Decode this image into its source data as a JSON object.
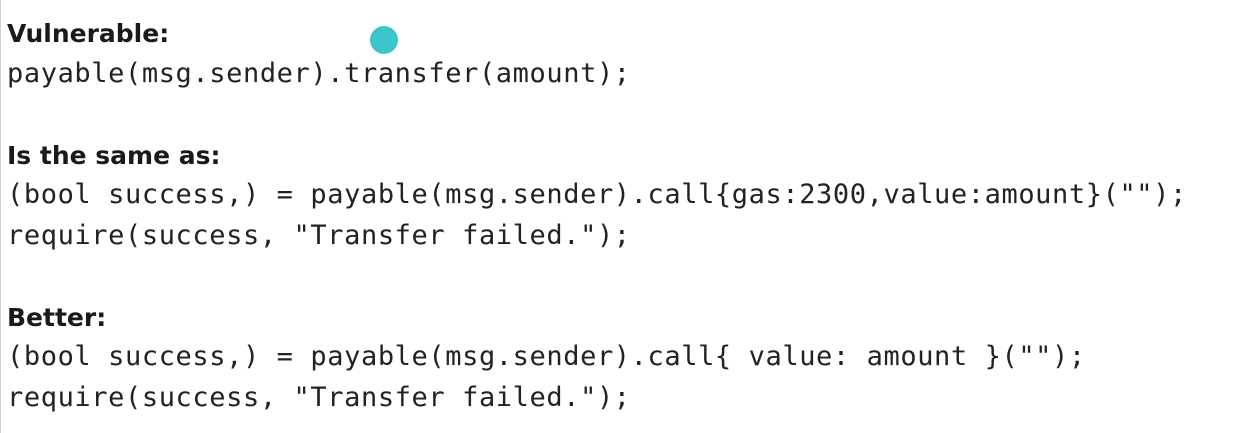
{
  "sections": {
    "vulnerable": {
      "heading": "Vulnerable:",
      "line1": "payable(msg.sender).transfer(amount);"
    },
    "same": {
      "heading": "Is the same as:",
      "line1": "(bool success,) = payable(msg.sender).call{gas:2300,value:amount}(\"\");",
      "line2": "require(success, \"Transfer failed.\");"
    },
    "better": {
      "heading": "Better:",
      "line1": "(bool success,) = payable(msg.sender).call{ value: amount }(\"\");",
      "line2": "require(success, \"Transfer failed.\");"
    }
  },
  "pointer": {
    "color": "#3cc6cc"
  }
}
